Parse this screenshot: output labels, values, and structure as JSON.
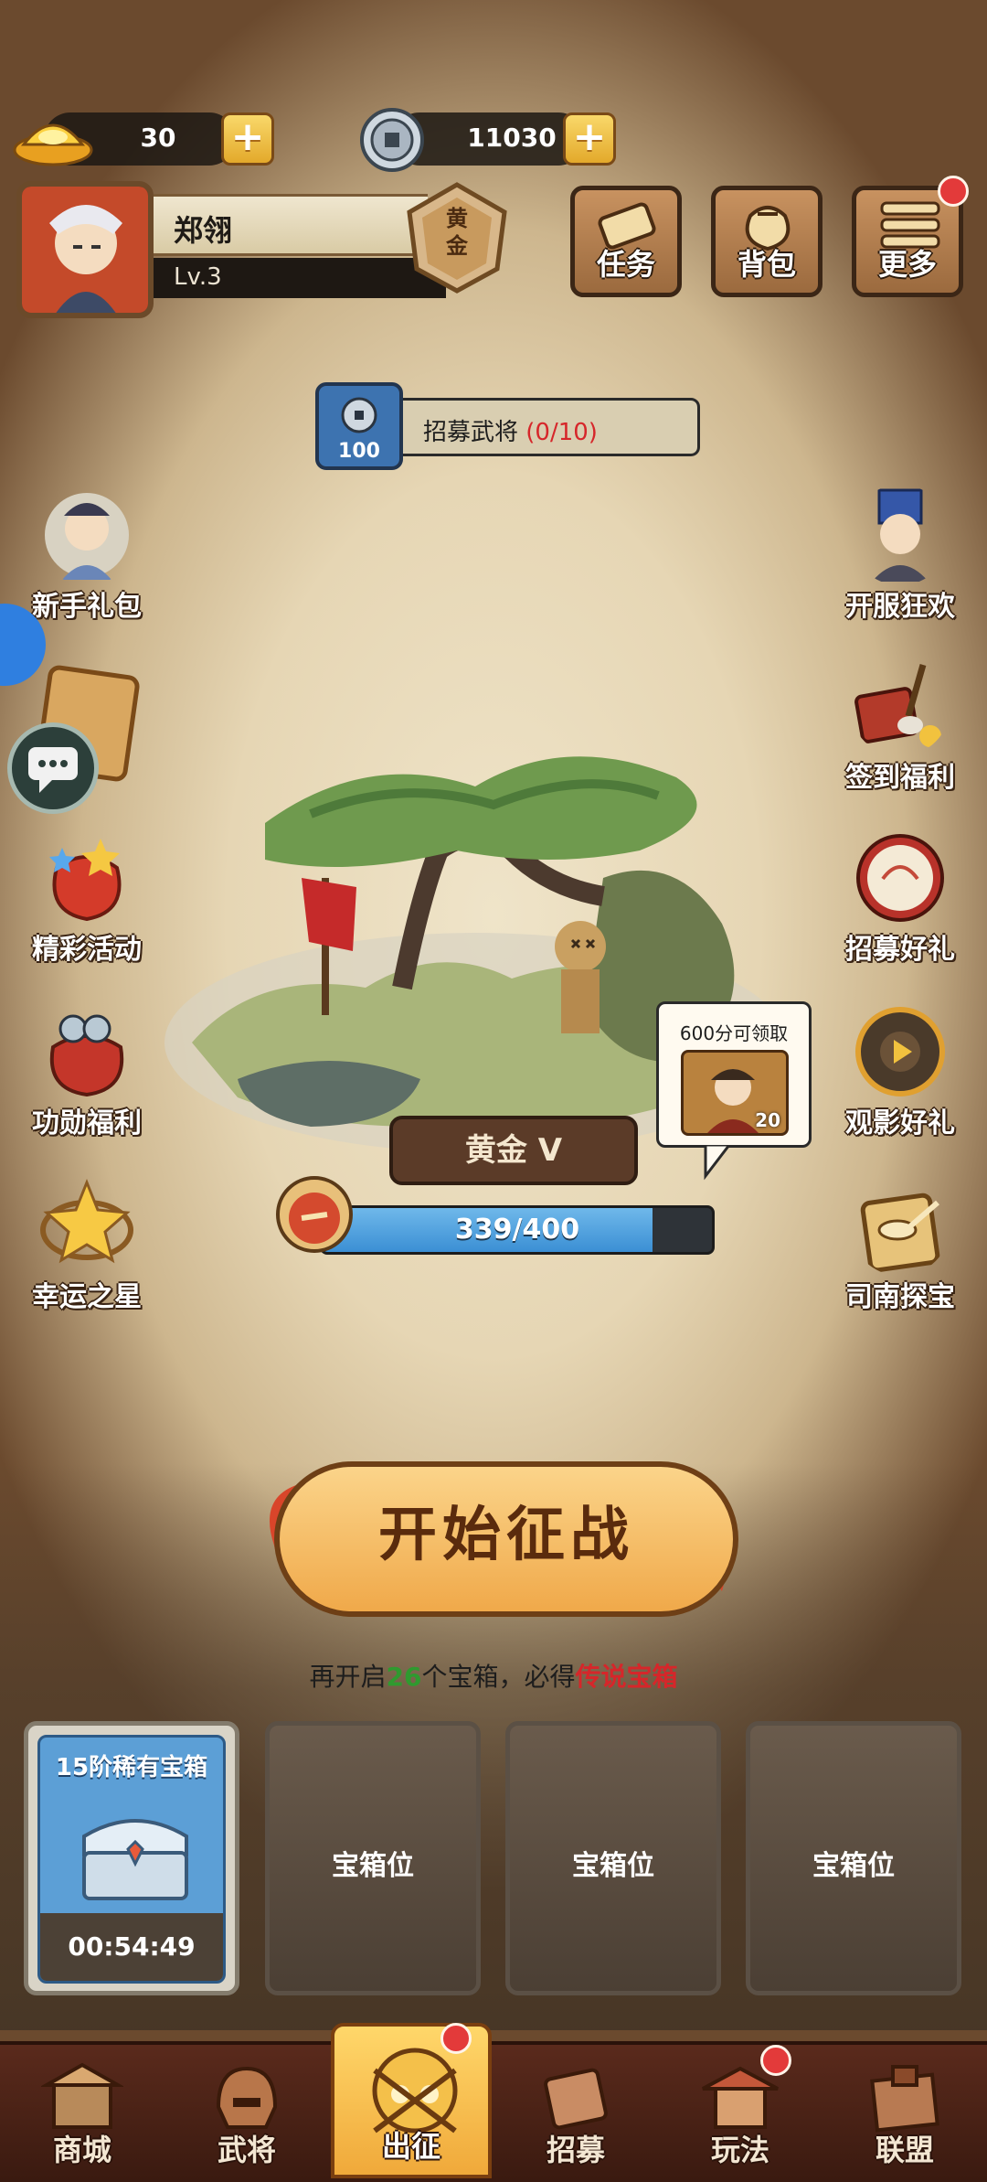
{
  "currency": {
    "gold": "30",
    "silver": "11030"
  },
  "profile": {
    "name": "郑翎",
    "level": "Lv.3",
    "rank_badge": "黄\n金"
  },
  "top_buttons": [
    {
      "label": "任务"
    },
    {
      "label": "背包"
    },
    {
      "label": "更多"
    }
  ],
  "recruit": {
    "cost": "100",
    "label": "招募武将",
    "progress": "(0/10)"
  },
  "left_side": [
    {
      "label": "新手礼包"
    },
    {
      "label": "精彩活动"
    },
    {
      "label": "功勋福利"
    },
    {
      "label": "幸运之星"
    }
  ],
  "right_side": [
    {
      "label": "开服狂欢"
    },
    {
      "label": "签到福利"
    },
    {
      "label": "招募好礼"
    },
    {
      "label": "观影好礼"
    },
    {
      "label": "司南探宝"
    }
  ],
  "rank": {
    "tier": "黄金 V",
    "progress_text": "339/400",
    "progress_fraction": 0.8475,
    "reward_hint": "600分可领取",
    "reward_count": "20"
  },
  "battle": {
    "start_label": "开始征战",
    "hint_prefix": "再开启",
    "hint_count": "26",
    "hint_middle": "个宝箱，必得",
    "hint_reward": "传说宝箱"
  },
  "chests": [
    {
      "title": "15阶稀有宝箱",
      "timer": "00:54:49"
    },
    {
      "label": "宝箱位"
    },
    {
      "label": "宝箱位"
    },
    {
      "label": "宝箱位"
    }
  ],
  "nav": [
    {
      "label": "商城"
    },
    {
      "label": "武将"
    },
    {
      "label": "出征"
    },
    {
      "label": "招募"
    },
    {
      "label": "玩法"
    },
    {
      "label": "联盟"
    }
  ],
  "colors": {
    "accent_red": "#e33a3a",
    "progress_blue": "#3b8fd4",
    "hint_green": "#2f9a2f",
    "hint_red": "#d6262a"
  }
}
